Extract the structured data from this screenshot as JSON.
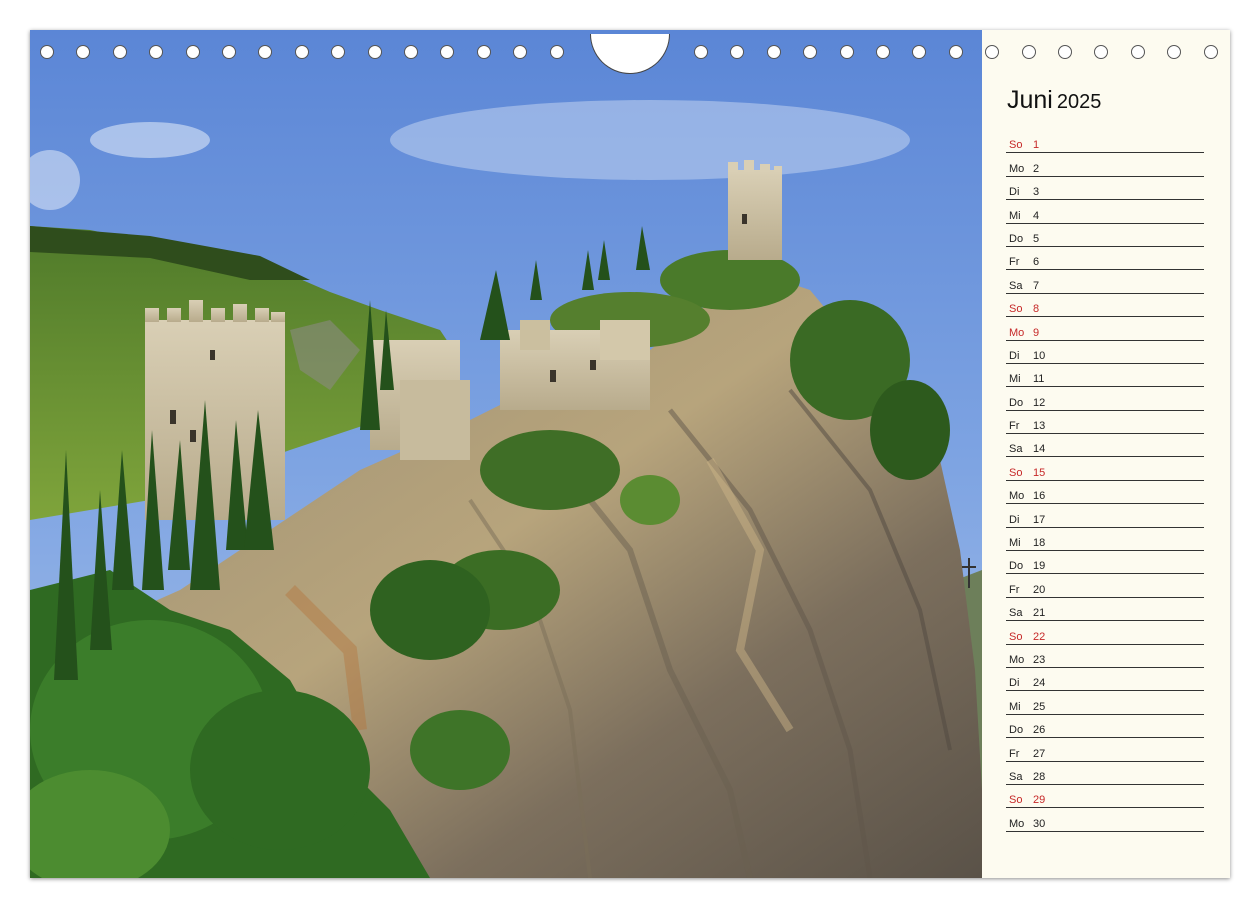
{
  "calendar": {
    "month": "Juni",
    "year": "2025",
    "colors": {
      "sunday": "#c62828",
      "weekday": "#222222",
      "paper": "#fdfbf0"
    },
    "days": [
      {
        "wd": "So",
        "d": "1",
        "sun": true
      },
      {
        "wd": "Mo",
        "d": "2"
      },
      {
        "wd": "Di",
        "d": "3"
      },
      {
        "wd": "Mi",
        "d": "4"
      },
      {
        "wd": "Do",
        "d": "5"
      },
      {
        "wd": "Fr",
        "d": "6"
      },
      {
        "wd": "Sa",
        "d": "7"
      },
      {
        "wd": "So",
        "d": "8",
        "sun": true
      },
      {
        "wd": "Mo",
        "d": "9",
        "sun": true
      },
      {
        "wd": "Di",
        "d": "10"
      },
      {
        "wd": "Mi",
        "d": "11"
      },
      {
        "wd": "Do",
        "d": "12"
      },
      {
        "wd": "Fr",
        "d": "13"
      },
      {
        "wd": "Sa",
        "d": "14"
      },
      {
        "wd": "So",
        "d": "15",
        "sun": true
      },
      {
        "wd": "Mo",
        "d": "16"
      },
      {
        "wd": "Di",
        "d": "17"
      },
      {
        "wd": "Mi",
        "d": "18"
      },
      {
        "wd": "Do",
        "d": "19"
      },
      {
        "wd": "Fr",
        "d": "20"
      },
      {
        "wd": "Sa",
        "d": "21"
      },
      {
        "wd": "So",
        "d": "22",
        "sun": true
      },
      {
        "wd": "Mo",
        "d": "23"
      },
      {
        "wd": "Di",
        "d": "24"
      },
      {
        "wd": "Mi",
        "d": "25"
      },
      {
        "wd": "Do",
        "d": "26"
      },
      {
        "wd": "Fr",
        "d": "27"
      },
      {
        "wd": "Sa",
        "d": "28"
      },
      {
        "wd": "So",
        "d": "29",
        "sun": true
      },
      {
        "wd": "Mo",
        "d": "30"
      }
    ]
  }
}
